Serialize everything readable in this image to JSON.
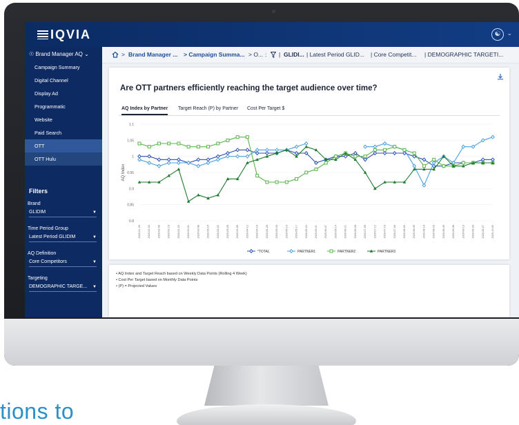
{
  "app": {
    "logo_text": "IQVIA",
    "user_icon": "user-circle-icon",
    "brand_color": "#0d2a63"
  },
  "sidebar": {
    "header": "Brand Manager AQ",
    "items": [
      {
        "label": "Campaign Summary"
      },
      {
        "label": "Digital Channel"
      },
      {
        "label": "Display Ad"
      },
      {
        "label": "Programmatic"
      },
      {
        "label": "Website"
      },
      {
        "label": "Paid Search"
      },
      {
        "label": "OTT"
      },
      {
        "label": "OTT Hulu"
      }
    ],
    "filters_label": "Filters",
    "filters": [
      {
        "label": "Brand",
        "value": "GLIDIM"
      },
      {
        "label": "Time Period Group",
        "value": "Latest Period GLIDIM"
      },
      {
        "label": "AQ Definition",
        "value": "Core Competitors"
      },
      {
        "label": "Targeting",
        "value": "DEMOGRAPHIC TARGE..."
      }
    ]
  },
  "breadcrumb": {
    "items": [
      "Brand Manager ...",
      "> Campaign Summa...",
      "> O...",
      ":",
      "GLIDI...",
      "| Latest Period GLID...",
      "| Core Competit...",
      "| DEMOGRAPHIC TARGETI..."
    ]
  },
  "card": {
    "title": "Are OTT partners efficiently reaching the target audience over time?",
    "tabs": [
      "AQ Index by Partner",
      "Target Reach (P) by Partner",
      "Cost Per Target $"
    ],
    "active_tab": "AQ Index by Partner"
  },
  "notes": [
    "• AQ Index and Target Reach based on Weekly Data Points (Rolling 4 Week)",
    "• Cost Per Target based on Monthly Data Points",
    "• (P) = Projected Values"
  ],
  "caption": "tions to",
  "chart_data": {
    "type": "line",
    "ylabel": "AQ Index",
    "ylim": [
      0.8,
      1.1
    ],
    "yticks": [
      0.8,
      0.85,
      0.9,
      0.95,
      1,
      1.05,
      1.1
    ],
    "ytick_labels": [
      "0.8",
      "0.85",
      "0.9",
      "0.95",
      "1",
      "1.05",
      "1.1"
    ],
    "x": [
      "2020-01-26",
      "2020-02-02",
      "2020-02-09",
      "2020-02-16",
      "2020-02-23",
      "2020-03-01",
      "2020-03-08",
      "2020-03-15",
      "2020-03-22",
      "2020-03-29",
      "2020-04-05",
      "2020-04-12",
      "2020-04-19",
      "2020-04-26",
      "2020-05-03",
      "2020-05-10",
      "2020-05-17",
      "2020-05-24",
      "2020-05-31",
      "2020-06-07",
      "2020-06-14",
      "2020-06-21",
      "2020-06-28",
      "2020-07-05",
      "2020-07-12",
      "2020-07-19",
      "2020-07-26",
      "2020-08-02",
      "2020-08-09",
      "2020-08-16",
      "2020-08-23",
      "2020-08-30",
      "2020-09-06",
      "2020-09-13",
      "2020-09-20",
      "2020-09-27",
      "2020-10-04"
    ],
    "series": [
      {
        "name": "*TOTAL",
        "color": "#2b4fb5",
        "marker": "diamond",
        "values": [
          1.0,
          1.0,
          0.99,
          0.99,
          0.99,
          0.98,
          0.99,
          0.99,
          1.0,
          1.01,
          1.02,
          1.02,
          1.01,
          1.01,
          1.01,
          1.02,
          1.01,
          1.01,
          0.98,
          0.99,
          1.0,
          1.0,
          1.01,
          0.99,
          1.01,
          1.01,
          1.01,
          1.01,
          1.0,
          0.99,
          0.97,
          0.97,
          0.98,
          0.98,
          0.98,
          0.99,
          0.99
        ]
      },
      {
        "name": "PARTNER1",
        "color": "#4a9fe0",
        "marker": "diamond",
        "values": [
          0.99,
          0.98,
          0.97,
          0.98,
          0.98,
          0.98,
          0.97,
          0.98,
          0.99,
          1.0,
          1.0,
          1.0,
          1.02,
          1.02,
          1.02,
          1.02,
          1.03,
          1.04,
          null,
          null,
          null,
          null,
          null,
          1.03,
          1.03,
          1.04,
          1.03,
          1.02,
          0.97,
          0.91,
          0.98,
          1.0,
          0.98,
          1.03,
          1.03,
          1.05,
          1.06
        ]
      },
      {
        "name": "PARTNER2",
        "color": "#58b548",
        "marker": "square",
        "values": [
          1.04,
          1.03,
          1.04,
          1.04,
          1.04,
          1.03,
          1.03,
          1.03,
          1.04,
          1.05,
          1.06,
          1.06,
          0.94,
          0.92,
          0.92,
          0.92,
          0.93,
          0.95,
          0.96,
          0.98,
          1.0,
          1.01,
          1.0,
          1.0,
          1.02,
          1.02,
          1.03,
          1.02,
          1.01,
          0.97,
          0.99,
          0.97,
          0.97,
          0.98,
          0.98,
          0.98,
          0.98
        ]
      },
      {
        "name": "PARTNER3",
        "color": "#1f7a30",
        "marker": "triangle",
        "values": [
          0.92,
          0.92,
          0.92,
          0.94,
          0.96,
          0.86,
          0.88,
          0.87,
          0.88,
          0.93,
          0.93,
          0.98,
          0.99,
          1.0,
          1.01,
          1.02,
          1.0,
          1.03,
          1.02,
          0.99,
          0.99,
          1.01,
          0.99,
          0.95,
          0.9,
          0.92,
          0.92,
          0.92,
          0.96,
          0.96,
          0.96,
          1.0,
          0.97,
          0.97,
          0.98,
          0.98,
          0.98
        ]
      }
    ],
    "legend_position": "bottom"
  }
}
